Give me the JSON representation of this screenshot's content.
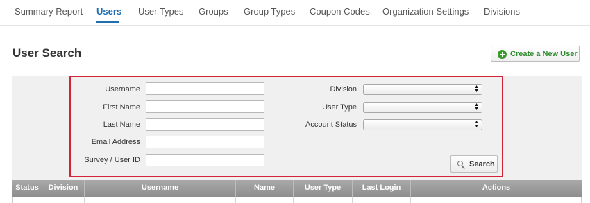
{
  "nav": {
    "items": [
      {
        "label": "Summary Report",
        "active": false
      },
      {
        "label": "Users",
        "active": true
      },
      {
        "label": "User Types",
        "active": false
      },
      {
        "label": "Groups",
        "active": false
      },
      {
        "label": "Group Types",
        "active": false
      },
      {
        "label": "Coupon Codes",
        "active": false
      },
      {
        "label": "Organization Settings",
        "active": false
      },
      {
        "label": "Divisions",
        "active": false
      }
    ]
  },
  "page": {
    "title": "User Search",
    "create_button_label": "Create a New User"
  },
  "search": {
    "fields_left": [
      {
        "label": "Username",
        "value": ""
      },
      {
        "label": "First Name",
        "value": ""
      },
      {
        "label": "Last Name",
        "value": ""
      },
      {
        "label": "Email Address",
        "value": ""
      },
      {
        "label": "Survey / User ID",
        "value": ""
      }
    ],
    "fields_right": [
      {
        "label": "Division",
        "value": ""
      },
      {
        "label": "User Type",
        "value": ""
      },
      {
        "label": "Account Status",
        "value": ""
      }
    ],
    "button_label": "Search"
  },
  "table": {
    "columns": [
      "Status",
      "Division",
      "Username",
      "Name",
      "User Type",
      "Last Login",
      "Actions"
    ]
  },
  "colors": {
    "accent": "#1f6fb2",
    "highlight": "#d2233a",
    "create_green": "#3a9b2a"
  }
}
